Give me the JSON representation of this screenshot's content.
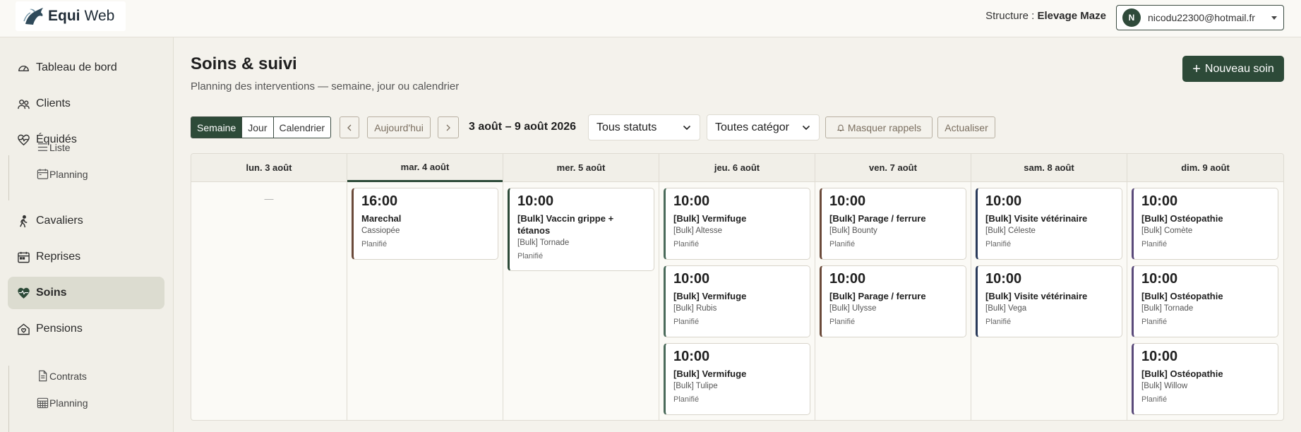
{
  "brand": {
    "name_bold": "Equi",
    "name_light": "Web"
  },
  "header": {
    "structure_label": "Structure : ",
    "structure_value": "Elevage Maze",
    "user_initial": "N",
    "user_email": "nicodu22300@hotmail.fr"
  },
  "sidebar": {
    "items": [
      {
        "label": "Tableau de bord",
        "icon": "gauge-icon"
      },
      {
        "label": "Clients",
        "icon": "users-icon"
      },
      {
        "label": "Équidés",
        "icon": "heart-pulse-icon"
      },
      {
        "label": "Cavaliers",
        "icon": "walking-person-icon"
      },
      {
        "label": "Reprises",
        "icon": "calendar-icon"
      },
      {
        "label": "Soins",
        "icon": "heart-pulse-icon",
        "active": true
      },
      {
        "label": "Pensions",
        "icon": "house-heart-icon"
      }
    ],
    "equides_sub": [
      {
        "label": "Liste",
        "icon": "list-icon"
      },
      {
        "label": "Planning",
        "icon": "calendar-week-icon"
      }
    ],
    "pensions_sub": [
      {
        "label": "Contrats",
        "icon": "document-icon"
      },
      {
        "label": "Planning",
        "icon": "calendar-grid-icon"
      }
    ]
  },
  "page": {
    "title": "Soins & suivi",
    "subtitle": "Planning des interventions — semaine, jour ou calendrier",
    "new_button": "Nouveau soin"
  },
  "toolbar": {
    "views": [
      "Semaine",
      "Jour",
      "Calendrier"
    ],
    "active_view": "Semaine",
    "today": "Aujourd'hui",
    "range": "3 août – 9 août 2026",
    "status_filter": "Tous statuts",
    "category_filter": "Toutes catégor",
    "hide_reminders": "Masquer rappels",
    "refresh": "Actualiser"
  },
  "calendar": {
    "days": [
      {
        "label": "lun. 3 août",
        "empty": "—",
        "events": []
      },
      {
        "label": "mar. 4 août",
        "today": true,
        "events": [
          {
            "time": "16:00",
            "title": "Marechal",
            "horse": "Cassiopée",
            "status": "Planifié",
            "color": "#6b4a3a"
          }
        ]
      },
      {
        "label": "mer. 5 août",
        "events": [
          {
            "time": "10:00",
            "title": "[Bulk] Vaccin grippe + tétanos",
            "horse": "[Bulk] Tornade",
            "status": "Planifié",
            "color": "#2d4a38"
          }
        ]
      },
      {
        "label": "jeu. 6 août",
        "events": [
          {
            "time": "10:00",
            "title": "[Bulk] Vermifuge",
            "horse": "[Bulk] Altesse",
            "status": "Planifié",
            "color": "#4a6a5a"
          },
          {
            "time": "10:00",
            "title": "[Bulk] Vermifuge",
            "horse": "[Bulk] Rubis",
            "status": "Planifié",
            "color": "#4a6a5a"
          },
          {
            "time": "10:00",
            "title": "[Bulk] Vermifuge",
            "horse": "[Bulk] Tulipe",
            "status": "Planifié",
            "color": "#4a6a5a"
          }
        ]
      },
      {
        "label": "ven. 7 août",
        "events": [
          {
            "time": "10:00",
            "title": "[Bulk] Parage / ferrure",
            "horse": "[Bulk] Bounty",
            "status": "Planifié",
            "color": "#6b4a3a"
          },
          {
            "time": "10:00",
            "title": "[Bulk] Parage / ferrure",
            "horse": "[Bulk] Ulysse",
            "status": "Planifié",
            "color": "#6b4a3a"
          }
        ]
      },
      {
        "label": "sam. 8 août",
        "events": [
          {
            "time": "10:00",
            "title": "[Bulk] Visite vétérinaire",
            "horse": "[Bulk] Céleste",
            "status": "Planifié",
            "color": "#2a3a5a"
          },
          {
            "time": "10:00",
            "title": "[Bulk] Visite vétérinaire",
            "horse": "[Bulk] Vega",
            "status": "Planifié",
            "color": "#2a3a5a"
          }
        ]
      },
      {
        "label": "dim. 9 août",
        "events": [
          {
            "time": "10:00",
            "title": "[Bulk] Ostéopathie",
            "horse": "[Bulk] Comète",
            "status": "Planifié",
            "color": "#5a4a7a"
          },
          {
            "time": "10:00",
            "title": "[Bulk] Ostéopathie",
            "horse": "[Bulk] Tornade",
            "status": "Planifié",
            "color": "#5a4a7a"
          },
          {
            "time": "10:00",
            "title": "[Bulk] Ostéopathie",
            "horse": "[Bulk] Willow",
            "status": "Planifié",
            "color": "#5a4a7a"
          }
        ]
      }
    ]
  }
}
